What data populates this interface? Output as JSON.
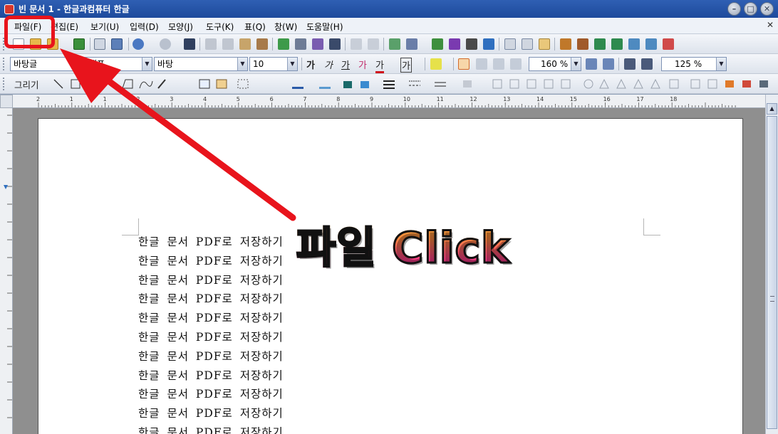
{
  "window": {
    "title": "빈 문서 1 - 한글과컴퓨터 한글",
    "buttons": [
      "minimize",
      "maximize",
      "close"
    ]
  },
  "menu": {
    "items": [
      "파일(F)",
      "편집(E)",
      "보기(U)",
      "입력(D)",
      "모양(J)",
      "도구(K)",
      "표(Q)",
      "창(W)",
      "도움말(H)"
    ],
    "close_glyph": "✕"
  },
  "format_toolbar": {
    "style_value": "바탕글",
    "style2_value": "대표",
    "font_value": "바탕",
    "size_value": "10",
    "line_spacing_value": "160 %",
    "zoom_value": "125 %",
    "char_buttons": [
      "가",
      "가",
      "가",
      "가",
      "가",
      "가"
    ]
  },
  "draw_toolbar": {
    "label": "그리기"
  },
  "ruler": {
    "marks": [
      "2",
      "1",
      "1",
      "2",
      "3",
      "4",
      "5",
      "6",
      "7",
      "8",
      "9",
      "10",
      "11",
      "12",
      "13",
      "14",
      "15",
      "16",
      "17",
      "18"
    ]
  },
  "document": {
    "lines": [
      "한글 문서 PDF로 저장하기",
      "한글 문서 PDF로 저장하기",
      "한글 문서 PDF로 저장하기",
      "한글 문서 PDF로 저장하기",
      "한글 문서 PDF로 저장하기",
      "한글 문서 PDF로 저장하기",
      "한글 문서 PDF로 저장하기",
      "한글 문서 PDF로 저장하기",
      "한글 문서 PDF로 저장하기",
      "한글 문서 PDF로 저장하기",
      "한글 문서 PDF로 저장하기"
    ]
  },
  "annotation": {
    "label": "파일 Click",
    "color": "#e8141c"
  }
}
